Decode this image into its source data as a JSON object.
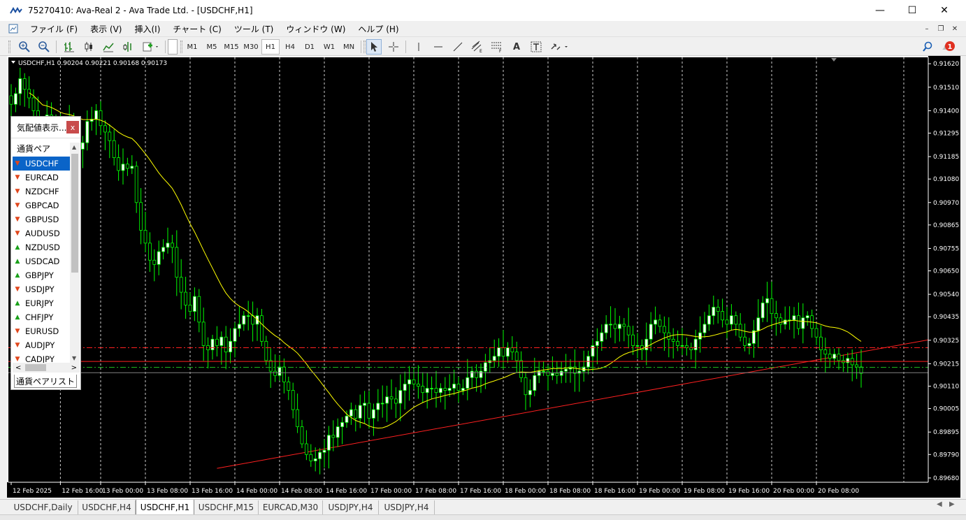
{
  "window": {
    "title": "75270410: Ava-Real 2 - Ava Trade Ltd. - [USDCHF,H1]",
    "minimize_icon": "minimize-icon",
    "maximize_icon": "maximize-icon",
    "close_icon": "close-icon"
  },
  "menu": {
    "items": [
      "ファイル (F)",
      "表示 (V)",
      "挿入(I)",
      "チャート (C)",
      "ツール (T)",
      "ウィンドウ (W)",
      "ヘルプ (H)"
    ]
  },
  "toolbar": {
    "timeframes": [
      "M1",
      "M5",
      "M15",
      "M30",
      "H1",
      "H4",
      "D1",
      "W1",
      "MN"
    ],
    "active_timeframe": "H1",
    "text_tool": "A",
    "notification_count": "1"
  },
  "chart": {
    "info": "USDCHF,H1  0.90204 0.90221 0.90168 0.90173",
    "current_price_label": "0.90173",
    "bid_label": "0.90226"
  },
  "chart_data": {
    "type": "candlestick",
    "symbol": "USDCHF",
    "timeframe": "H1",
    "ohlc_header": {
      "open": 0.90204,
      "high": 0.90221,
      "low": 0.90168,
      "close": 0.90173
    },
    "price_ticks": [
      "0.91620",
      "0.91510",
      "0.91400",
      "0.91295",
      "0.91185",
      "0.91080",
      "0.90970",
      "0.90865",
      "0.90755",
      "0.90650",
      "0.90540",
      "0.90435",
      "0.90325",
      "0.90215",
      "0.90110",
      "0.90005",
      "0.89895",
      "0.89790",
      "0.89680"
    ],
    "time_ticks": [
      "12 Feb 2025",
      "12 Feb 16:00",
      "13 Feb 00:00",
      "13 Feb 08:00",
      "13 Feb 16:00",
      "14 Feb 00:00",
      "14 Feb 08:00",
      "14 Feb 16:00",
      "17 Feb 00:00",
      "17 Feb 08:00",
      "17 Feb 16:00",
      "18 Feb 00:00",
      "18 Feb 08:00",
      "18 Feb 16:00",
      "19 Feb 00:00",
      "19 Feb 08:00",
      "19 Feb 16:00",
      "20 Feb 00:00",
      "20 Feb 08:00"
    ],
    "ylim": [
      0.8966,
      0.9165
    ],
    "closes": [
      0.9143,
      0.9148,
      0.9155,
      0.915,
      0.9146,
      0.914,
      0.9132,
      0.9128,
      0.9138,
      0.9135,
      0.913,
      0.9126,
      0.913,
      0.9134,
      0.9128,
      0.9122,
      0.9125,
      0.9135,
      0.9136,
      0.914,
      0.9133,
      0.913,
      0.9126,
      0.9118,
      0.9112,
      0.9115,
      0.9113,
      0.9114,
      0.9097,
      0.9084,
      0.9078,
      0.907,
      0.9068,
      0.9074,
      0.9076,
      0.9078,
      0.9076,
      0.9062,
      0.9055,
      0.9049,
      0.9046,
      0.9053,
      0.9041,
      0.903,
      0.9028,
      0.9033,
      0.903,
      0.9034,
      0.9027,
      0.9032,
      0.9038,
      0.904,
      0.9044,
      0.9044,
      0.904,
      0.9044,
      0.9032,
      0.9023,
      0.9018,
      0.9016,
      0.902,
      0.9013,
      0.9009,
      0.9,
      0.8992,
      0.8984,
      0.8979,
      0.8976,
      0.8977,
      0.898,
      0.8981,
      0.8988,
      0.8987,
      0.8992,
      0.8994,
      0.8997,
      0.9,
      0.8996,
      0.9002,
      0.9003,
      0.8996,
      0.9,
      0.9003,
      0.9003,
      0.9006,
      0.9005,
      0.9003,
      0.9009,
      0.9012,
      0.9014,
      0.9012,
      0.9011,
      0.9008,
      0.901,
      0.901,
      0.9008,
      0.901,
      0.9009,
      0.901,
      0.9012,
      0.9009,
      0.901,
      0.9015,
      0.9018,
      0.9015,
      0.9018,
      0.9022,
      0.9023,
      0.9025,
      0.9029,
      0.9025,
      0.9029,
      0.9027,
      0.9023,
      0.9015,
      0.9007,
      0.9009,
      0.9016,
      0.9018,
      0.9018,
      0.9016,
      0.9017,
      0.9016,
      0.9018,
      0.9019,
      0.902,
      0.9017,
      0.9018,
      0.902,
      0.9025,
      0.903,
      0.9032,
      0.9036,
      0.904,
      0.904,
      0.9038,
      0.904,
      0.9039,
      0.9035,
      0.903,
      0.903,
      0.9028,
      0.9033,
      0.904,
      0.9042,
      0.9039,
      0.9036,
      0.9033,
      0.9032,
      0.903,
      0.903,
      0.9029,
      0.9028,
      0.9033,
      0.9036,
      0.904,
      0.9044,
      0.9048,
      0.9046,
      0.9042,
      0.904,
      0.9044,
      0.904,
      0.9034,
      0.903,
      0.9031,
      0.9037,
      0.9043,
      0.905,
      0.9052,
      0.9045,
      0.9043,
      0.904,
      0.9042,
      0.9042,
      0.9044,
      0.9038,
      0.9043,
      0.9044,
      0.9038,
      0.9034,
      0.9028,
      0.9026,
      0.9024,
      0.9026,
      0.9023,
      0.9022,
      0.9024,
      0.9021,
      0.902,
      0.9017
    ],
    "moving_average": "yellow",
    "horizontal_lines": [
      {
        "price": 0.9029,
        "color": "#ff2020",
        "style": "dash-dot"
      },
      {
        "price": 0.90226,
        "color": "#ff2020",
        "style": "solid"
      },
      {
        "price": 0.90198,
        "color": "#20c020",
        "style": "dash-dot"
      },
      {
        "price": 0.90173,
        "color": "#808080",
        "style": "solid"
      }
    ],
    "trend_line": {
      "from_bar": 46,
      "from_price": 0.89725,
      "to_bar": 205,
      "to_price": 0.90327,
      "color": "#ff2020"
    },
    "colors": {
      "background": "#000000",
      "bull": "#ffffff",
      "bear": "#000000",
      "wick": "#00ff00",
      "ma": "#ffff00",
      "grid": "#ffffff",
      "axis_text": "#ffffff"
    }
  },
  "market_watch": {
    "title": "気配値表示...",
    "close_label": "x",
    "column_header": "通貨ペア",
    "tab_label": "通貨ペアリスト",
    "scroll_left": "<",
    "scroll_right": ">",
    "symbols": [
      {
        "name": "USDCHF",
        "dir": "down",
        "selected": true
      },
      {
        "name": "EURCAD",
        "dir": "down"
      },
      {
        "name": "NZDCHF",
        "dir": "down"
      },
      {
        "name": "GBPCAD",
        "dir": "down"
      },
      {
        "name": "GBPUSD",
        "dir": "down"
      },
      {
        "name": "AUDUSD",
        "dir": "down"
      },
      {
        "name": "NZDUSD",
        "dir": "up"
      },
      {
        "name": "USDCAD",
        "dir": "up"
      },
      {
        "name": "GBPJPY",
        "dir": "up"
      },
      {
        "name": "USDJPY",
        "dir": "down"
      },
      {
        "name": "EURJPY",
        "dir": "up"
      },
      {
        "name": "CHFJPY",
        "dir": "up"
      },
      {
        "name": "EURUSD",
        "dir": "down"
      },
      {
        "name": "AUDJPY",
        "dir": "down"
      },
      {
        "name": "CADJPY",
        "dir": "down"
      }
    ]
  },
  "chart_tabs": [
    "USDCHF,Daily",
    "USDCHF,H4",
    "USDCHF,H1",
    "USDCHF,M15",
    "EURCAD,M30",
    "USDJPY,H4",
    "USDJPY,H4"
  ],
  "active_chart_tab": "USDCHF,H1"
}
